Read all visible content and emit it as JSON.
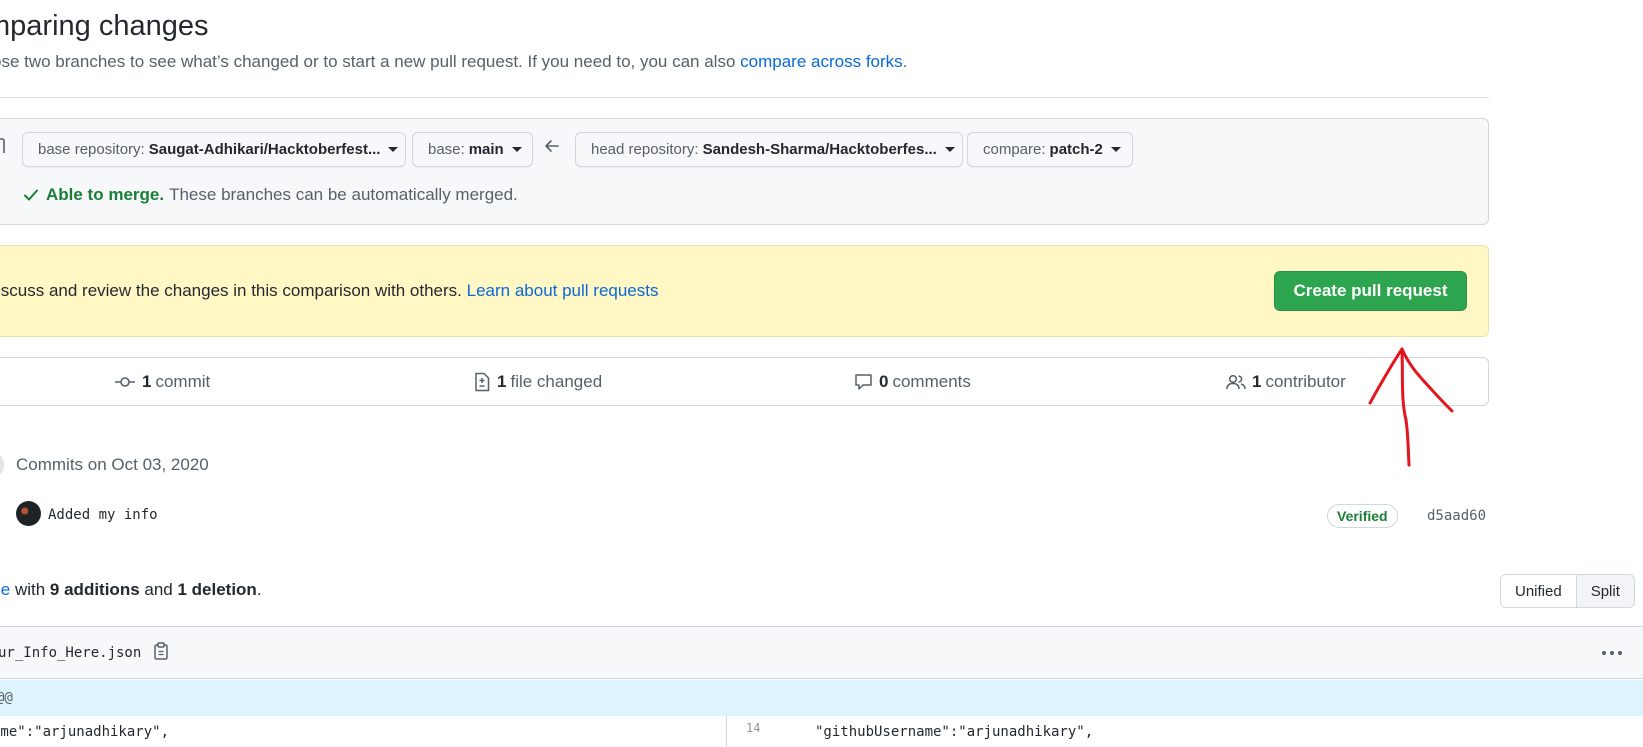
{
  "header": {
    "title": "mparing changes",
    "subtitle_prefix": "ose two branches to see what’s changed or to start a new pull request. If you need to, you can also ",
    "subtitle_link": "compare across forks",
    "subtitle_suffix": "."
  },
  "range": {
    "base_repo_label": "base repository:",
    "base_repo_value": "Saugat-Adhikari/Hacktoberfest...",
    "base_label": "base:",
    "base_value": "main",
    "head_repo_label": "head repository:",
    "head_repo_value": "Sandesh-Sharma/Hacktoberfes...",
    "compare_label": "compare:",
    "compare_value": "patch-2",
    "merge_status": "Able to merge.",
    "merge_message": "These branches can be automatically merged."
  },
  "flash": {
    "text": "iscuss and review the changes in this comparison with others. ",
    "link": "Learn about pull requests",
    "button": "Create pull request"
  },
  "stats": {
    "commits_count": "1",
    "commits_label": "commit",
    "files_count": "1",
    "files_label": "file changed",
    "comments_count": "0",
    "comments_label": "comments",
    "contributors_count": "1",
    "contributors_label": "contributor"
  },
  "commits": {
    "date_label": "Commits on Oct 03, 2020",
    "message": "Added my info",
    "badge": "Verified",
    "sha": "d5aad60"
  },
  "diff": {
    "summary_link": "le",
    "summary_with": " with ",
    "additions": "9 additions",
    "and": " and ",
    "deletions": "1 deletion",
    "period": ".",
    "view_unified": "Unified",
    "view_split": "Split",
    "file_name": "ur_Info_Here.json",
    "hunk": "@@",
    "left_code": "ame\":\"arjunadhikary\",",
    "right_line_number": "14",
    "right_code": "\"githubUsername\":\"arjunadhikary\","
  },
  "colors": {
    "accent": "#0969da",
    "success": "#2da44e",
    "flash_bg": "#fff8c5",
    "annotation": "#e3161e"
  }
}
